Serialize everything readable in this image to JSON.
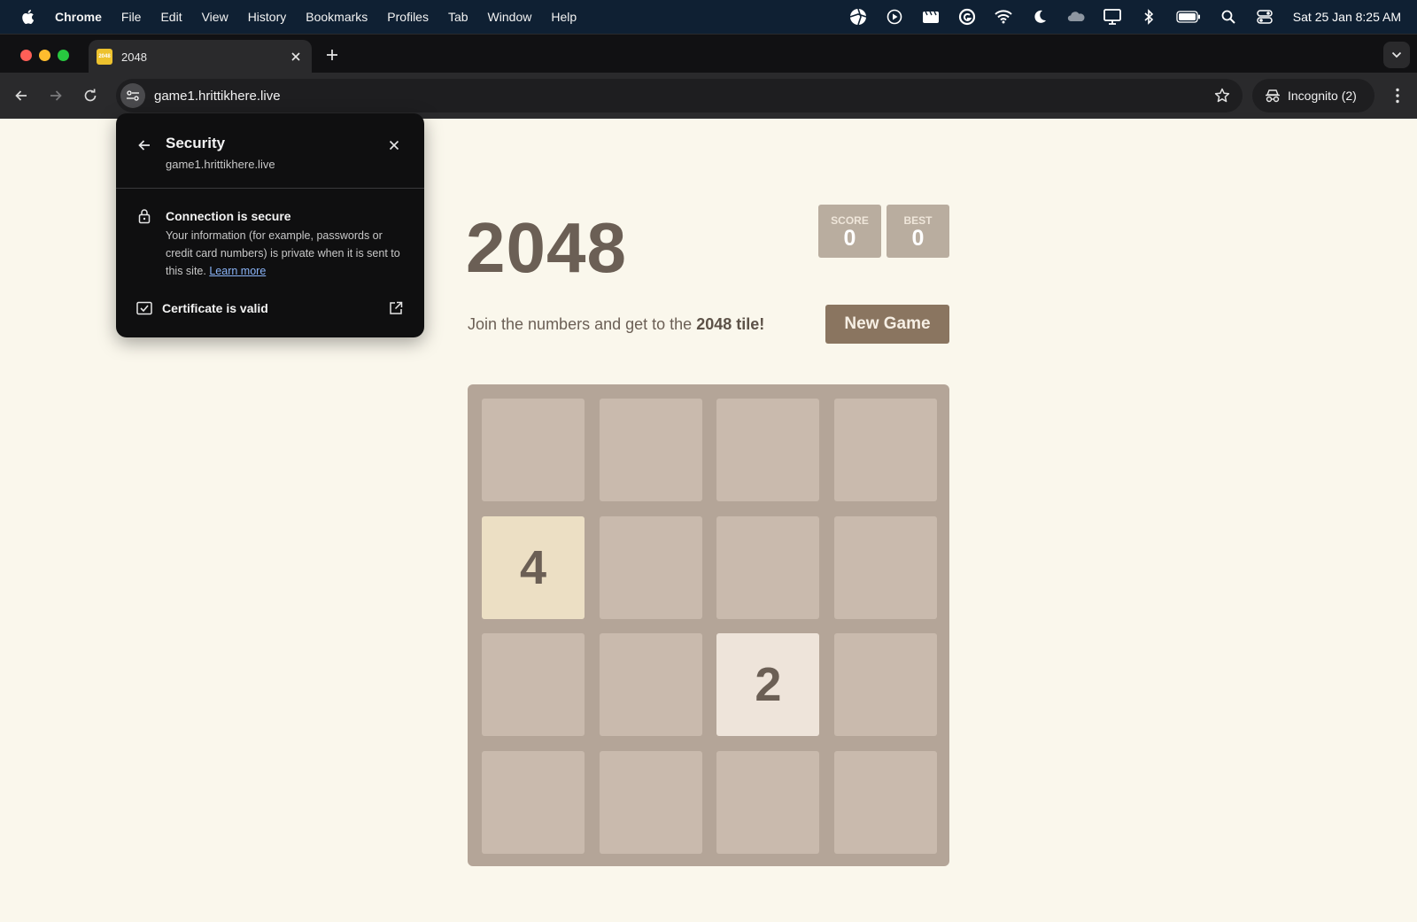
{
  "menubar": {
    "app": "Chrome",
    "items": [
      "File",
      "Edit",
      "View",
      "History",
      "Bookmarks",
      "Profiles",
      "Tab",
      "Window",
      "Help"
    ],
    "status_icons": [
      "aperture-icon",
      "play-circle-icon",
      "clapper-icon",
      "grammarly-icon",
      "wifi-icon",
      "moon-icon",
      "cloud-icon",
      "display-icon",
      "bluetooth-icon",
      "battery-icon",
      "search-icon",
      "control-center-icon"
    ],
    "clock": "Sat 25 Jan  8:25 AM"
  },
  "tab": {
    "favicon_text": "2048",
    "title": "2048"
  },
  "toolbar": {
    "url": "game1.hrittikhere.live",
    "incognito_label": "Incognito (2)"
  },
  "security_popup": {
    "title": "Security",
    "host": "game1.hrittikhere.live",
    "connection_title": "Connection is secure",
    "connection_body": "Your information (for example, passwords or credit card numbers) is private when it is sent to this site.",
    "learn_more": "Learn more",
    "certificate_label": "Certificate is valid"
  },
  "game": {
    "title": "2048",
    "score_label": "SCORE",
    "score_value": "0",
    "best_label": "BEST",
    "best_value": "0",
    "intro_prefix": "Join the numbers and get to the",
    "intro_bold": "2048 tile!",
    "new_game_label": "New Game",
    "grid": [
      [
        "",
        "",
        "",
        ""
      ],
      [
        "4",
        "",
        "",
        ""
      ],
      [
        "",
        "",
        "2",
        ""
      ],
      [
        "",
        "",
        "",
        ""
      ]
    ]
  },
  "colors": {
    "page_bg": "#faf7ec",
    "board_bg": "#b4a598",
    "empty_cell": "#c9baad",
    "tile_2": "#eee4da",
    "tile_4": "#ecdfc4",
    "text_dark": "#6b5f55",
    "new_game_bg": "#8a7560"
  }
}
